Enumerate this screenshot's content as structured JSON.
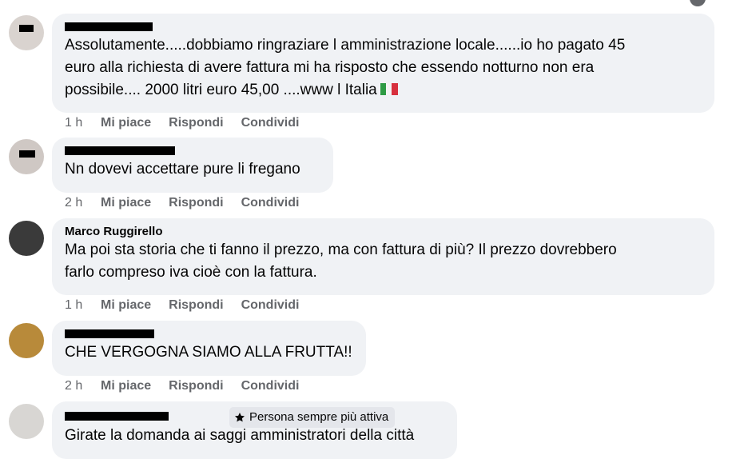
{
  "top_fragment": "… … …",
  "actions": {
    "like": "Mi piace",
    "reply": "Rispondi",
    "share": "Condividi"
  },
  "comments": [
    {
      "author": "",
      "text_lines": [
        "Assolutamente.....dobbiamo ringraziare l amministrazione locale......io ho pagato 45",
        "euro alla richiesta di avere fattura mi ha risposto che essendo notturno non era",
        "possibile.... 2000 litri euro 45,00 ....www l Italia"
      ],
      "emoji": "italy-flag",
      "time": "1 h"
    },
    {
      "author": "",
      "text_lines": [
        "Nn dovevi accettare pure li fregano"
      ],
      "time": "2 h"
    },
    {
      "author": "Marco Ruggirello",
      "text_lines": [
        "Ma poi sta storia che ti fanno il prezzo, ma con fattura di più? Il prezzo dovrebbero",
        "farlo compreso iva cioè con la fattura."
      ],
      "time": "1 h"
    },
    {
      "author": "",
      "text_lines": [
        "CHE VERGOGNA SIAMO ALLA FRUTTA!!"
      ],
      "time": "2 h"
    },
    {
      "author": "",
      "badge": "Persona sempre più attiva",
      "text_lines": [
        "Girate la domanda ai saggi amministratori della città"
      ]
    }
  ]
}
